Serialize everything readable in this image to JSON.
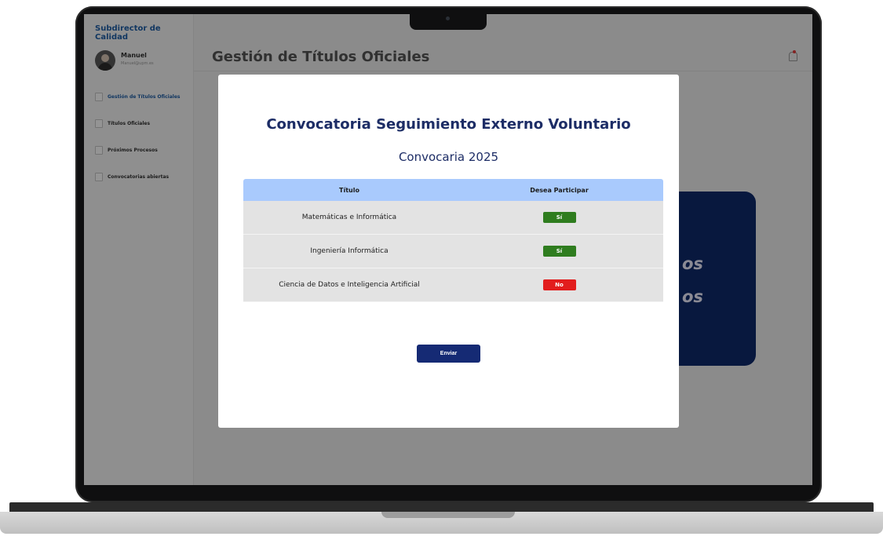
{
  "sidebar": {
    "brand": "Subdirector de Calidad",
    "user": {
      "name": "Manuel",
      "email": "Manuel@upm.es"
    },
    "items": [
      {
        "label": "Gestión de Títulos Oficiales",
        "active": true
      },
      {
        "label": "Títulos Oficiales",
        "active": false
      },
      {
        "label": "Próximos Procesos",
        "active": false
      },
      {
        "label": "Convocatorias abiertas",
        "active": false
      }
    ]
  },
  "header": {
    "title": "Gestión de Títulos Oficiales"
  },
  "background_card": {
    "line1": "os",
    "line2": "os"
  },
  "modal": {
    "title": "Convocatoria Seguimiento Externo Voluntario",
    "subtitle": "Convocaria 2025",
    "columns": [
      "Título",
      "Desea Participar"
    ],
    "rows": [
      {
        "title": "Matemáticas e Informática",
        "choice": "Sí",
        "status": "yes"
      },
      {
        "title": "Ingeniería Informática",
        "choice": "Sí",
        "status": "yes"
      },
      {
        "title": "Ciencia de Datos e Inteligencia Artificial",
        "choice": "No",
        "status": "no"
      }
    ],
    "submit_label": "Enviar"
  },
  "colors": {
    "brand": "#1f5fa8",
    "modal_title": "#1d2d66",
    "table_header": "#a9cafd",
    "yes": "#2f7d1f",
    "no": "#e21d1d",
    "button": "#152a74"
  }
}
